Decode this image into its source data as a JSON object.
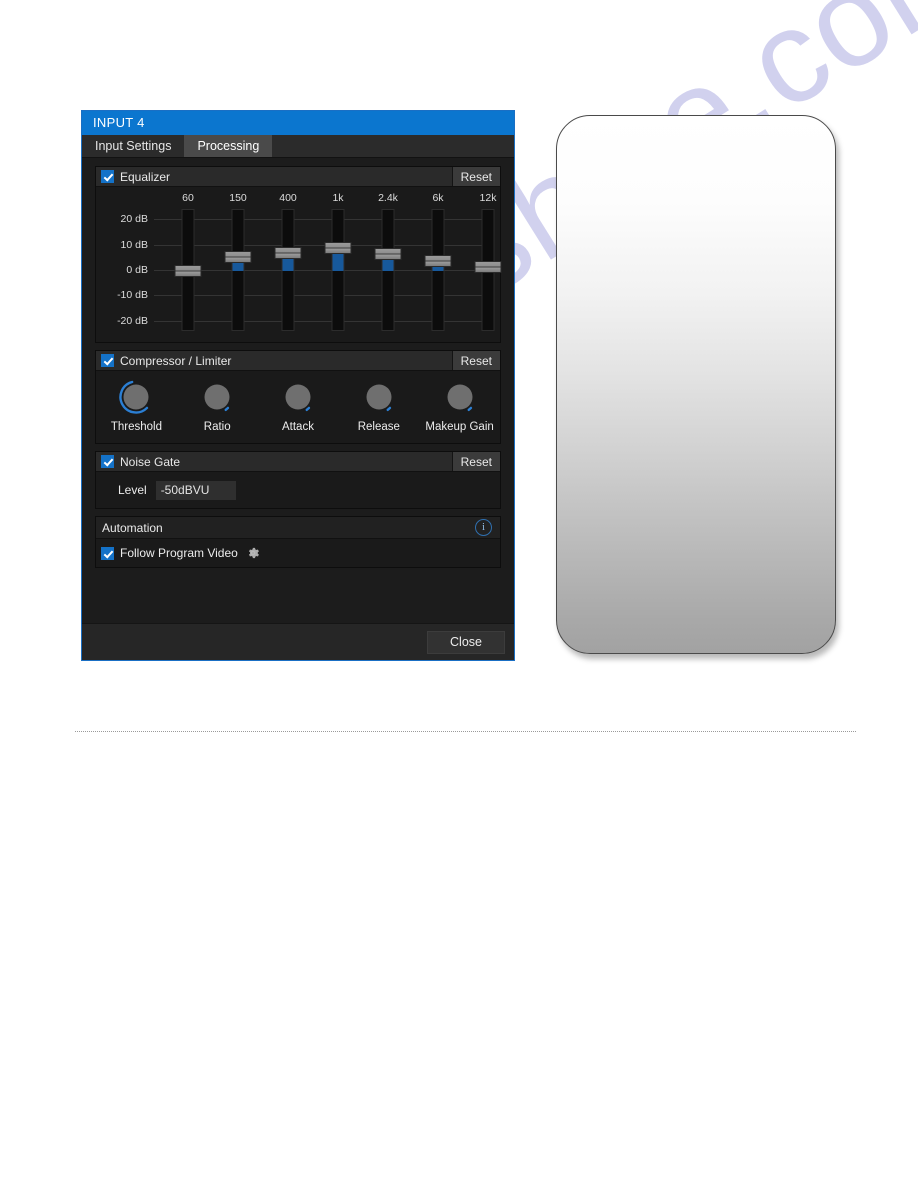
{
  "watermark": {
    "text": "manualshive.com"
  },
  "dialog": {
    "title": "INPUT 4",
    "tabs": [
      {
        "label": "Input Settings",
        "active": false
      },
      {
        "label": "Processing",
        "active": true
      }
    ],
    "close_label": "Close"
  },
  "equalizer": {
    "title": "Equalizer",
    "reset_label": "Reset",
    "enabled": true,
    "db_labels": [
      "20 dB",
      "10 dB",
      "0 dB",
      "-10 dB",
      "-20 dB"
    ],
    "db_values": [
      20,
      10,
      0,
      -10,
      -20
    ],
    "bands": [
      {
        "freq": "60",
        "gain_db": 0.0
      },
      {
        "freq": "150",
        "gain_db": 5.5
      },
      {
        "freq": "400",
        "gain_db": 7.0
      },
      {
        "freq": "1k",
        "gain_db": 9.0
      },
      {
        "freq": "2.4k",
        "gain_db": 6.5
      },
      {
        "freq": "6k",
        "gain_db": 4.0
      },
      {
        "freq": "12k",
        "gain_db": 1.5
      }
    ]
  },
  "compressor": {
    "title": "Compressor / Limiter",
    "reset_label": "Reset",
    "enabled": true,
    "knobs": [
      {
        "label": "Threshold",
        "arc_percent": 78
      },
      {
        "label": "Ratio",
        "arc_percent": 4
      },
      {
        "label": "Attack",
        "arc_percent": 4
      },
      {
        "label": "Release",
        "arc_percent": 4
      },
      {
        "label": "Makeup Gain",
        "arc_percent": 4
      }
    ]
  },
  "noise_gate": {
    "title": "Noise Gate",
    "reset_label": "Reset",
    "enabled": true,
    "level_label": "Level",
    "level_value": "-50dBVU",
    "level_placeholder": "-50dBVU"
  },
  "automation": {
    "title": "Automation",
    "info_icon_glyph": "i",
    "follow_label": "Follow Program Video",
    "follow_enabled": true,
    "gear_icon": "gear-icon"
  },
  "colors": {
    "titlebar_blue": "#0b76cf",
    "accent_blue": "#1472c8",
    "slider_fill": "#17599c",
    "panel_bg": "#1c1c1c",
    "watermark": "#c9c9ec"
  }
}
